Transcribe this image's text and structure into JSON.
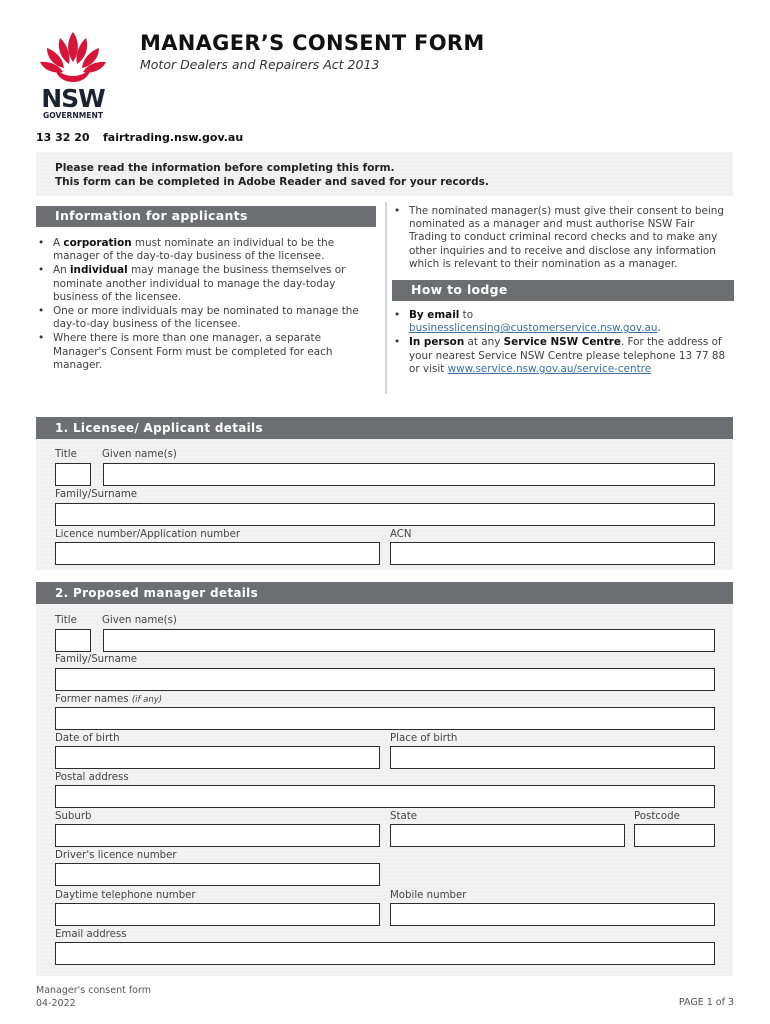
{
  "header": {
    "logo_text": "NSW",
    "logo_subtext": "GOVERNMENT",
    "title": "MANAGER’S CONSENT FORM",
    "subtitle": "Motor Dealers and Repairers Act 2013",
    "phone": "13 32 20",
    "website": "fairtrading.nsw.gov.au"
  },
  "notice": {
    "line1": "Please read the information before completing this form.",
    "line2": "This form can be completed in Adobe Reader and saved for your records."
  },
  "info_applicants": {
    "heading": "Information for applicants",
    "items": [
      {
        "pre": "A ",
        "bold": "corporation",
        "post": " must nominate an individual to be the manager of the day-to-day business of the licensee."
      },
      {
        "pre": "An ",
        "bold": "individual",
        "post": " may manage the business themselves or nominate another individual to manage the day-today business of the licensee."
      },
      {
        "pre": "",
        "bold": "",
        "post": "One or more individuals may be nominated to manage the day-to-day business of the licensee."
      },
      {
        "pre": "",
        "bold": "",
        "post": "Where there is more than one manager, a separate Manager's Consent Form must be completed for each manager."
      }
    ]
  },
  "info_right": {
    "consent_item": "The nominated manager(s) must give their consent to being nominated as a manager and must authorise NSW Fair Trading to conduct criminal record checks and to make any other inquiries and to receive and disclose any information which is relevant to their nomination as a manager."
  },
  "how_to_lodge": {
    "heading": "How to lodge",
    "email_bold": "By email",
    "email_to": " to",
    "email_address": "businesslicensing@customerservice.nsw.gov.au",
    "email_end": ".",
    "person_bold": "In person",
    "person_mid": " at any ",
    "person_centre": "Service NSW Centre",
    "person_text": ". For the address of your nearest Service NSW Centre please telephone 13 77 88 or visit ",
    "person_link": "www.service.nsw.gov.au/service-centre"
  },
  "section1": {
    "heading": "1. Licensee/ Applicant details",
    "labels": {
      "title": "Title",
      "given_names": "Given name(s)",
      "surname": "Family/Surname",
      "licence_number": "Licence number/Application number",
      "acn": "ACN"
    },
    "values": {
      "title": "",
      "given_names": "",
      "surname": "",
      "licence_number": "",
      "acn": ""
    }
  },
  "section2": {
    "heading": "2. Proposed manager details",
    "labels": {
      "title": "Title",
      "given_names": "Given name(s)",
      "surname": "Family/Surname",
      "former_names": "Former names",
      "former_names_note": "(if any)",
      "dob": "Date of birth",
      "pob": "Place of birth",
      "postal_address": "Postal address",
      "suburb": "Suburb",
      "state": "State",
      "postcode": "Postcode",
      "drivers_licence": "Driver's licence number",
      "daytime_phone": "Daytime telephone number",
      "mobile": "Mobile number",
      "email": "Email address"
    },
    "values": {
      "title": "",
      "given_names": "",
      "surname": "",
      "former_names": "",
      "dob": "",
      "pob": "",
      "postal_address": "",
      "suburb": "",
      "state": "",
      "postcode": "",
      "drivers_licence": "",
      "daytime_phone": "",
      "mobile": "",
      "email": ""
    }
  },
  "footer": {
    "form_name": "Manager's consent form",
    "version": "04-2022",
    "page": "PAGE 1 of 3"
  },
  "colors": {
    "nsw_red": "#d7153a",
    "nsw_navy": "#1c2331",
    "bar_gray": "#6d6e71",
    "panel_gray": "#f2f2f2"
  }
}
